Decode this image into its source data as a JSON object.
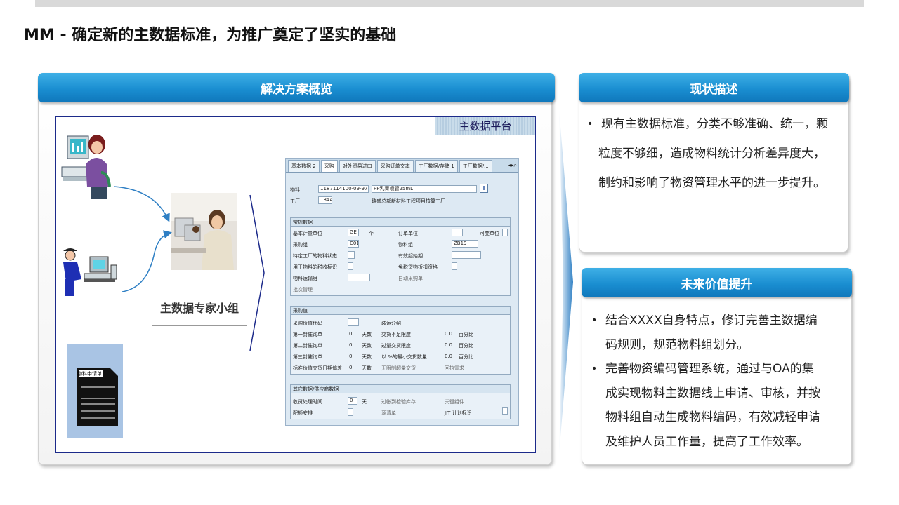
{
  "page": {
    "title": "MM - 确定新的主数据标准，为推广奠定了坚实的基础"
  },
  "overview": {
    "header": "解决方案概览",
    "platform_label": "主数据平台",
    "expert_group_label": "主数据专家小组",
    "form_doc_label": "物料申请单"
  },
  "sap": {
    "tabs": [
      "基本数据 2",
      "采购",
      "对外贸易进口",
      "采购订单文本",
      "工厂数据/存储 1",
      "工厂数据/..."
    ],
    "active_tab": "采购",
    "header_rows": {
      "material_label": "物料",
      "material_value": "1187114100-09-97",
      "material_desc": "PP乳膏喷管25mL",
      "plant_label": "工厂",
      "plant_value": "184A",
      "plant_desc": "瑞盛总部新材料工程项目核算工厂"
    },
    "general": {
      "title": "常规数据",
      "base_unit_label": "基本计量单位",
      "base_unit_value": "GE",
      "base_unit_desc": "个",
      "order_unit_label": "订单单位",
      "var_unit_label": "可变单位",
      "purch_group_label": "采购组",
      "purch_group_value": "C01",
      "mat_group_label": "物料组",
      "mat_group_value": "ZB19",
      "plant_status_label": "特定工厂的物料状态",
      "valid_from_label": "有效起始期",
      "tax_ind_label": "用于物料的税收标识",
      "tax_exempt_label": "免税货物折扣资格",
      "freight_group_label": "物料运输组",
      "auto_po_label": "自动采购单",
      "batch_mgmt_label": "批次管理"
    },
    "purchasing_values": {
      "title": "采购值",
      "key_label": "采购价值代码",
      "shipping_instr_label": "装运介绍",
      "reminder1_label": "第一封催询单",
      "reminder1_value": "0",
      "reminder1_unit": "天数",
      "under_tol_label": "交货不足限度",
      "under_tol_value": "0.0",
      "under_tol_unit": "百分比",
      "reminder2_label": "第二封催询单",
      "reminder2_value": "0",
      "reminder2_unit": "天数",
      "over_tol_label": "过量交货限度",
      "over_tol_value": "0.0",
      "over_tol_unit": "百分比",
      "reminder3_label": "第三封催询单",
      "reminder3_value": "0",
      "reminder3_unit": "天数",
      "min_qty_label": "以 %的最小交货数量",
      "min_qty_value": "0.0",
      "min_qty_unit": "百分比",
      "std_dev_label": "标准价值交货日期偏差",
      "std_dev_value": "0",
      "std_dev_unit": "天数",
      "unlimited_over_label": "无限制超量交货",
      "ack_req_label": "回执需求"
    },
    "other": {
      "title": "其它数据/供应商数据",
      "gr_time_label": "收货处理时间",
      "gr_time_value": "0",
      "gr_time_unit": "天",
      "post_insp_label": "过帐到检验库存",
      "critical_part_label": "关键组件",
      "quota_label": "配额安排",
      "source_list_label": "源清单",
      "jit_label": "JIT 计划标识"
    }
  },
  "status": {
    "header": "现状描述",
    "bullets": [
      "现有主数据标准，分类不够准确、统一，颗粒度不够细，造成物料统计分析差异度大，制约和影响了物资管理水平的进一步提升。"
    ],
    "lines": [
      "现有主数据标准，分类不够准确、统一，颗",
      "粒度不够细，造成物料统计分析差异度大，",
      "制约和影响了物资管理水平的进一步提升。"
    ]
  },
  "future": {
    "header": "未来价值提升",
    "bullet1_lines": [
      "结合XXXX自身特点，修订完善主数据编",
      "码规则，规范物料组划分。"
    ],
    "bullet2_lines": [
      "完善物资编码管理系统，通过与OA的集",
      "成实现物料主数据线上申请、审核，并按",
      "物料组自动生成物料编码，有效减轻申请",
      "及维护人员工作量，提高了工作效率。"
    ]
  },
  "colors": {
    "header_blue": "#1a8ed1",
    "frame_navy": "#1c2a8a",
    "arrow_blue": "#2e7fc4"
  }
}
